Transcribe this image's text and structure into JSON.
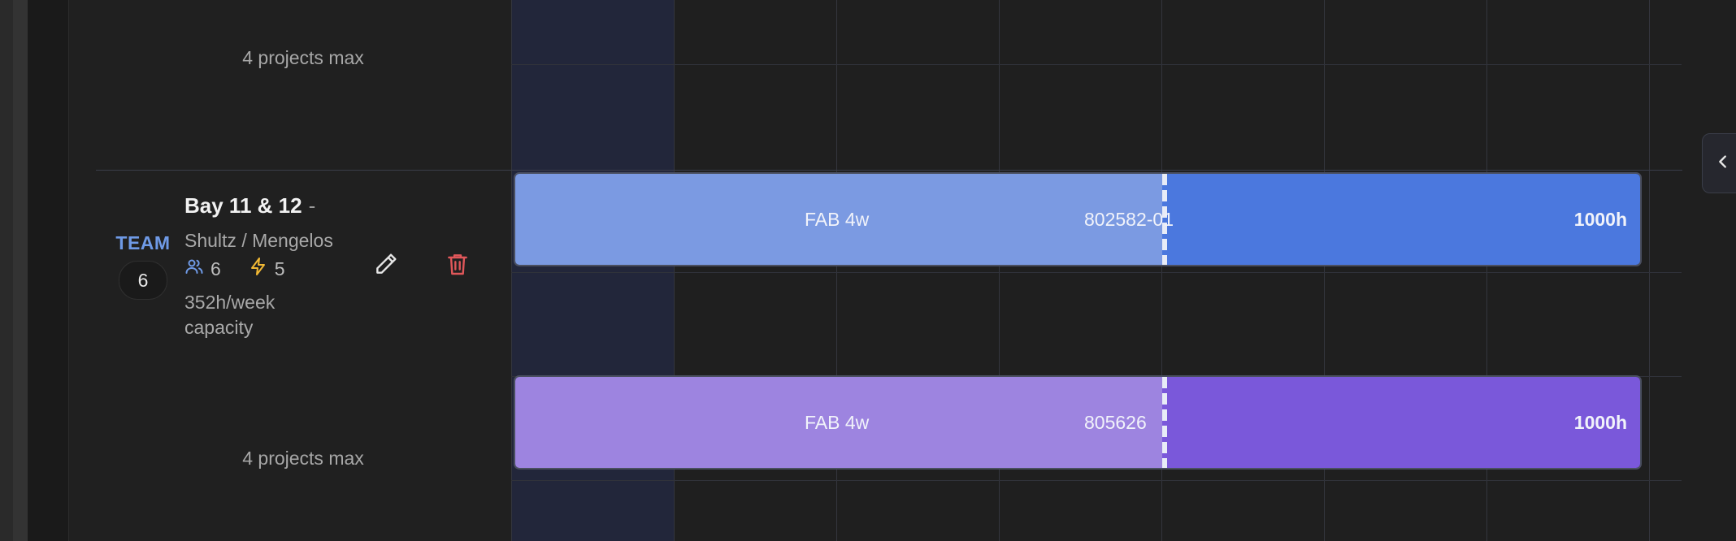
{
  "capacity_rows": [
    {
      "label": "4 projects max"
    },
    {
      "label": "4 projects max"
    }
  ],
  "team": {
    "tag": "TEAM",
    "number": "6",
    "name": "Bay 11 & 12",
    "name_suffix": "-",
    "leads": "Shultz / Mengelos",
    "members_count": "6",
    "electrical_count": "5",
    "capacity": "352h/week capacity"
  },
  "actions": {
    "edit_icon": "pencil-icon",
    "delete_icon": "trash-icon"
  },
  "bars": [
    {
      "phase": "FAB 4w",
      "project": "802582-01",
      "hours": "1000h",
      "color_light": "#7b9ae2",
      "color_dark": "#4b78de"
    },
    {
      "phase": "FAB 4w",
      "project": "805626",
      "hours": "1000h",
      "color_light": "#9d84e0",
      "color_dark": "#7a58da"
    }
  ],
  "colors": {
    "accent": "#6f9ae6",
    "delete": "#e0575a",
    "electric": "#f2b934"
  },
  "side_tab_icon": "chevron-left-icon"
}
